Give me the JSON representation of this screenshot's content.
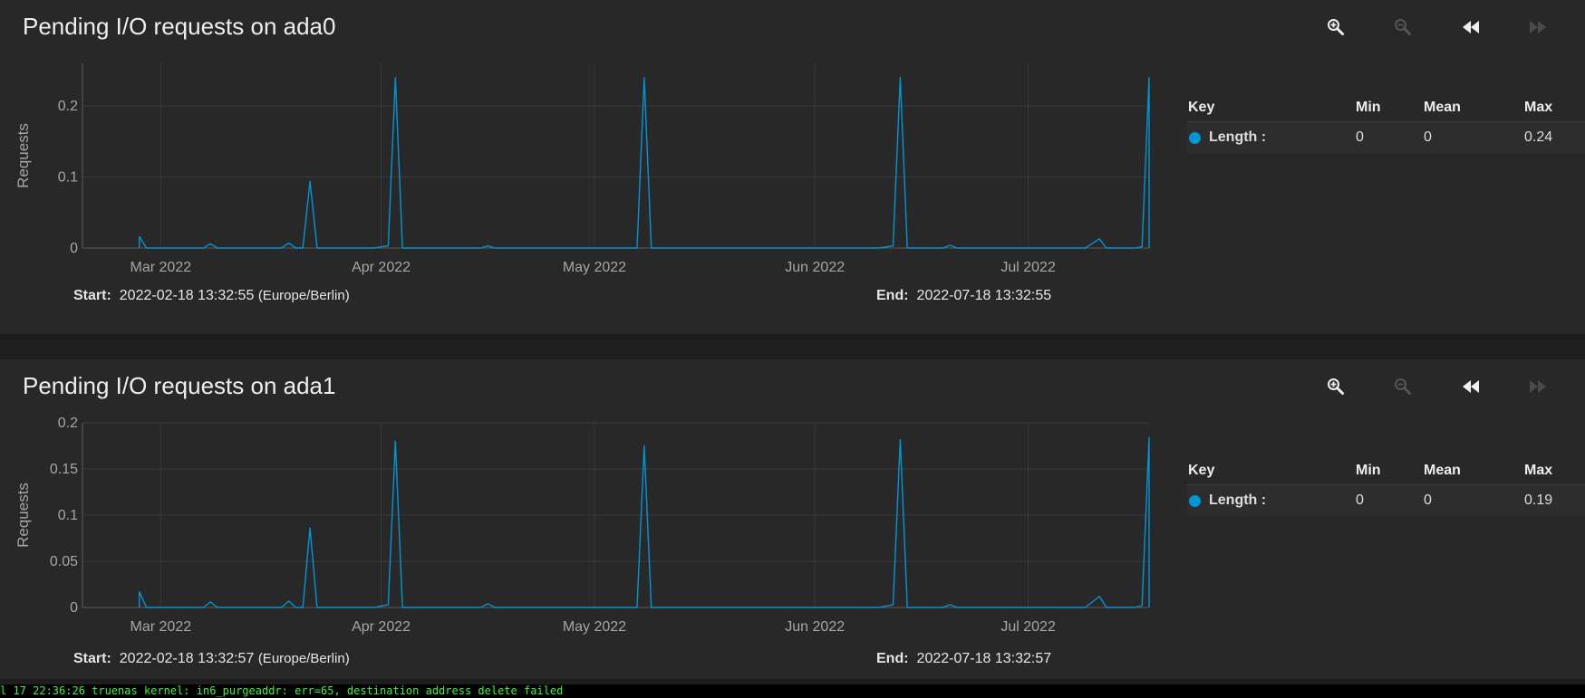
{
  "panels": [
    {
      "title": "Pending I/O requests on ada0",
      "start_label": "Start:",
      "start_value": "2022-02-18 13:32:55",
      "timezone": "(Europe/Berlin)",
      "end_label": "End:",
      "end_value": "2022-07-18 13:32:55",
      "legend": {
        "headers": [
          "Key",
          "Min",
          "Mean",
          "Max"
        ],
        "rows": [
          {
            "key": "Length :",
            "min": "0",
            "mean": "0",
            "max": "0.24",
            "color": "#0095d5"
          }
        ]
      }
    },
    {
      "title": "Pending I/O requests on ada1",
      "start_label": "Start:",
      "start_value": "2022-02-18 13:32:57",
      "timezone": "(Europe/Berlin)",
      "end_label": "End:",
      "end_value": "2022-07-18 13:32:57",
      "legend": {
        "headers": [
          "Key",
          "Min",
          "Mean",
          "Max"
        ],
        "rows": [
          {
            "key": "Length :",
            "min": "0",
            "mean": "0",
            "max": "0.19",
            "color": "#0095d5"
          }
        ]
      }
    }
  ],
  "toolbar_icons": [
    "zoom-in-icon",
    "zoom-out-icon",
    "step-backward-icon",
    "step-forward-icon"
  ],
  "console_line": "l 17 22:36:26 truenas kernel: in6_purgeaddr: err=65, destination address delete failed",
  "chart_data": [
    {
      "type": "line",
      "ylabel": "Requests",
      "xlim": [
        "2022-02-18",
        "2022-07-18"
      ],
      "ylim": [
        0,
        0.26
      ],
      "x_ticks": [
        {
          "label": "Mar 2022",
          "date": "2022-03-01"
        },
        {
          "label": "Apr 2022",
          "date": "2022-04-01"
        },
        {
          "label": "May 2022",
          "date": "2022-05-01"
        },
        {
          "label": "Jun 2022",
          "date": "2022-06-01"
        },
        {
          "label": "Jul 2022",
          "date": "2022-07-01"
        }
      ],
      "y_ticks": [
        {
          "label": "0",
          "value": 0
        },
        {
          "label": "0.1",
          "value": 0.1
        },
        {
          "label": "0.2",
          "value": 0.2
        }
      ],
      "grid": true,
      "series": [
        {
          "name": "Length",
          "color": "#0095d5",
          "points": [
            [
              "2022-02-26",
              0.016
            ],
            [
              "2022-02-27",
              0
            ],
            [
              "2022-03-07",
              0
            ],
            [
              "2022-03-08",
              0.006
            ],
            [
              "2022-03-09",
              0
            ],
            [
              "2022-03-18",
              0
            ],
            [
              "2022-03-19",
              0.007
            ],
            [
              "2022-03-20",
              0
            ],
            [
              "2022-03-21",
              0
            ],
            [
              "2022-03-22",
              0.094
            ],
            [
              "2022-03-23",
              0
            ],
            [
              "2022-03-31",
              0
            ],
            [
              "2022-04-02",
              0.003
            ],
            [
              "2022-04-03",
              0.24
            ],
            [
              "2022-04-04",
              0
            ],
            [
              "2022-04-15",
              0
            ],
            [
              "2022-04-16",
              0.003
            ],
            [
              "2022-04-17",
              0
            ],
            [
              "2022-05-07",
              0
            ],
            [
              "2022-05-08",
              0.24
            ],
            [
              "2022-05-09",
              0
            ],
            [
              "2022-06-10",
              0
            ],
            [
              "2022-06-12",
              0.003
            ],
            [
              "2022-06-13",
              0.24
            ],
            [
              "2022-06-14",
              0
            ],
            [
              "2022-06-19",
              0
            ],
            [
              "2022-06-20",
              0.004
            ],
            [
              "2022-06-21",
              0
            ],
            [
              "2022-07-09",
              0
            ],
            [
              "2022-07-11",
              0.013
            ],
            [
              "2022-07-12",
              0
            ],
            [
              "2022-07-16",
              0
            ],
            [
              "2022-07-17",
              0.002
            ],
            [
              "2022-07-18",
              0.24
            ],
            [
              "2022-07-18",
              0
            ]
          ]
        }
      ]
    },
    {
      "type": "line",
      "ylabel": "Requests",
      "xlim": [
        "2022-02-18",
        "2022-07-18"
      ],
      "ylim": [
        0,
        0.2
      ],
      "x_ticks": [
        {
          "label": "Mar 2022",
          "date": "2022-03-01"
        },
        {
          "label": "Apr 2022",
          "date": "2022-04-01"
        },
        {
          "label": "May 2022",
          "date": "2022-05-01"
        },
        {
          "label": "Jun 2022",
          "date": "2022-06-01"
        },
        {
          "label": "Jul 2022",
          "date": "2022-07-01"
        }
      ],
      "y_ticks": [
        {
          "label": "0",
          "value": 0
        },
        {
          "label": "0.05",
          "value": 0.05
        },
        {
          "label": "0.1",
          "value": 0.1
        },
        {
          "label": "0.15",
          "value": 0.15
        },
        {
          "label": "0.2",
          "value": 0.2
        }
      ],
      "grid": true,
      "series": [
        {
          "name": "Length",
          "color": "#0095d5",
          "points": [
            [
              "2022-02-26",
              0.017
            ],
            [
              "2022-02-27",
              0
            ],
            [
              "2022-03-07",
              0
            ],
            [
              "2022-03-08",
              0.006
            ],
            [
              "2022-03-09",
              0
            ],
            [
              "2022-03-18",
              0
            ],
            [
              "2022-03-19",
              0.007
            ],
            [
              "2022-03-20",
              0
            ],
            [
              "2022-03-21",
              0
            ],
            [
              "2022-03-22",
              0.086
            ],
            [
              "2022-03-23",
              0
            ],
            [
              "2022-03-31",
              0
            ],
            [
              "2022-04-02",
              0.003
            ],
            [
              "2022-04-03",
              0.18
            ],
            [
              "2022-04-04",
              0
            ],
            [
              "2022-04-15",
              0
            ],
            [
              "2022-04-16",
              0.004
            ],
            [
              "2022-04-17",
              0
            ],
            [
              "2022-05-07",
              0
            ],
            [
              "2022-05-08",
              0.175
            ],
            [
              "2022-05-09",
              0
            ],
            [
              "2022-06-10",
              0
            ],
            [
              "2022-06-12",
              0.003
            ],
            [
              "2022-06-13",
              0.182
            ],
            [
              "2022-06-14",
              0
            ],
            [
              "2022-06-19",
              0
            ],
            [
              "2022-06-20",
              0.003
            ],
            [
              "2022-06-21",
              0
            ],
            [
              "2022-07-09",
              0
            ],
            [
              "2022-07-11",
              0.012
            ],
            [
              "2022-07-12",
              0
            ],
            [
              "2022-07-16",
              0
            ],
            [
              "2022-07-17",
              0.002
            ],
            [
              "2022-07-18",
              0.184
            ],
            [
              "2022-07-18",
              0
            ]
          ]
        }
      ]
    }
  ]
}
